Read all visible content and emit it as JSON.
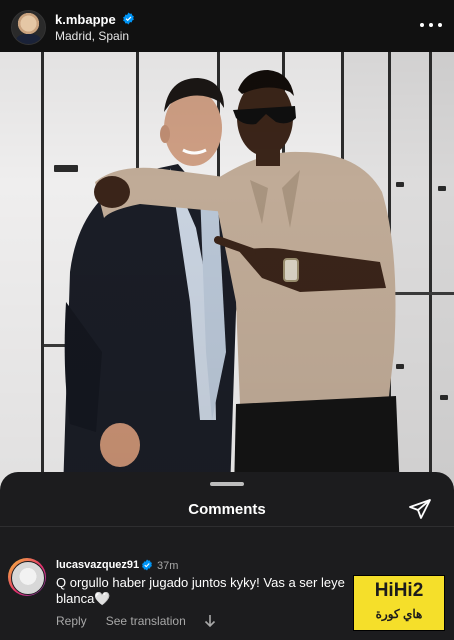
{
  "post": {
    "username": "k.mbappe",
    "location": "Madrid, Spain"
  },
  "comments_sheet": {
    "title": "Comments"
  },
  "comment": {
    "username": "lucasvazquez91",
    "time": "37m",
    "text": "Q orgullo haber jugado juntos kyky! Vas a ser leye blanca🤍",
    "reply_label": "Reply",
    "translation_label": "See translation"
  },
  "watermark": {
    "title": "HiHi2",
    "subtitle": "هاي كورة"
  },
  "colors": {
    "verified": "#0095f6",
    "sheet_bg": "#1c1c1e",
    "watermark_bg": "#f5df2a"
  },
  "icons": [
    "verified-badge-icon",
    "more-options-icon",
    "send-icon",
    "heart-icon",
    "chevron-down-icon"
  ]
}
